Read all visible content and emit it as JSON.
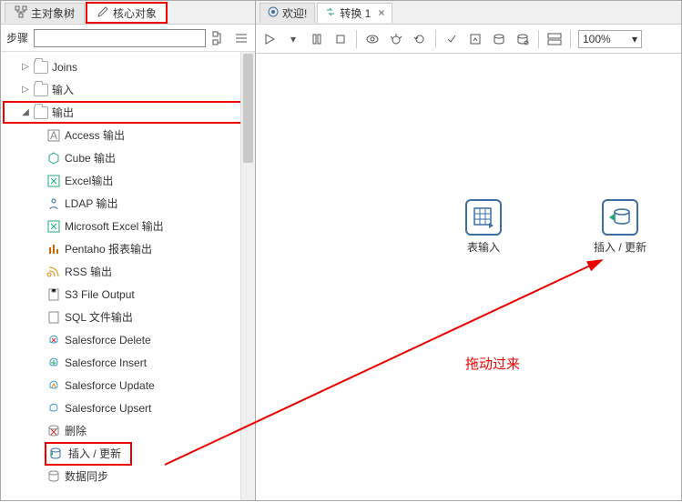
{
  "left_tabs": {
    "main_tree": "主对象树",
    "core": "核心对象"
  },
  "filter": {
    "label": "步骤",
    "placeholder": ""
  },
  "tree": {
    "joins": "Joins",
    "input": "输入",
    "output": "输出",
    "items": [
      "Access 输出",
      "Cube 输出",
      "Excel输出",
      "LDAP 输出",
      "Microsoft Excel 输出",
      "Pentaho 报表输出",
      "RSS 输出",
      "S3 File Output",
      "SQL 文件输出",
      "Salesforce Delete",
      "Salesforce Insert",
      "Salesforce Update",
      "Salesforce Upsert",
      "删除",
      "插入 / 更新",
      "数据同步"
    ]
  },
  "right_tabs": {
    "welcome": "欢迎!",
    "transform": "转换 1"
  },
  "zoom": "100%",
  "canvas": {
    "node1": "表输入",
    "node2": "插入 / 更新",
    "annotation": "拖动过来"
  }
}
